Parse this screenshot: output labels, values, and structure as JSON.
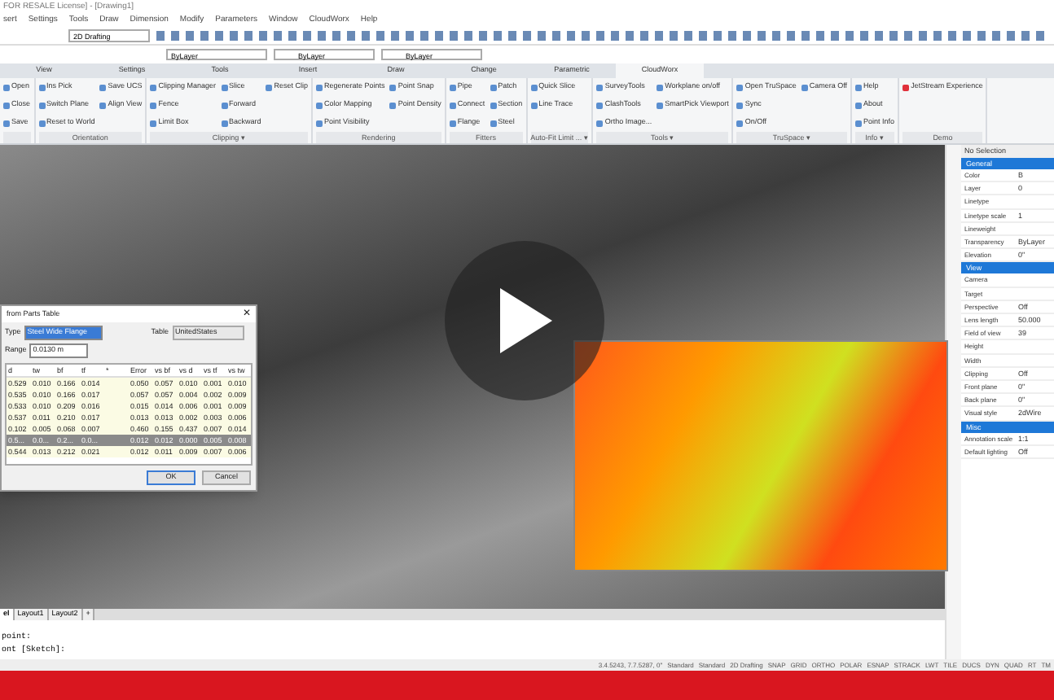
{
  "window": {
    "title": "FOR RESALE License] - [Drawing1]"
  },
  "menu": [
    "sert",
    "Settings",
    "Tools",
    "Draw",
    "Dimension",
    "Modify",
    "Parameters",
    "Window",
    "CloudWorx",
    "Help"
  ],
  "toolbar": {
    "workspace": "2D Drafting",
    "layer": "ByLayer",
    "linetype": "ByLayer",
    "lineweight": "ByLayer"
  },
  "ribbon_tabs": [
    {
      "label": "View",
      "selected": false
    },
    {
      "label": "Settings",
      "selected": false
    },
    {
      "label": "Tools",
      "selected": false
    },
    {
      "label": "Insert",
      "selected": false
    },
    {
      "label": "Draw",
      "selected": false
    },
    {
      "label": "Change",
      "selected": false
    },
    {
      "label": "Parametric",
      "selected": false
    },
    {
      "label": "CloudWorx",
      "selected": true
    }
  ],
  "ribbon_groups": [
    {
      "items": [
        "Open",
        "Close",
        "Save"
      ]
    },
    {
      "label": "Orientation",
      "items": [
        "Ins Pick",
        "Switch Plane",
        "Reset to World",
        "Save UCS",
        "Align View"
      ]
    },
    {
      "label": "Clipping ▾",
      "items": [
        "Clipping Manager",
        "Fence",
        "Limit Box",
        "Slice",
        "Forward",
        "Backward",
        "Reset Clip"
      ]
    },
    {
      "label": "Rendering",
      "items": [
        "Regenerate Points",
        "Color Mapping",
        "Point Visibility",
        "Point Snap",
        "Point Density"
      ]
    },
    {
      "label": "Fitters",
      "items": [
        "Pipe",
        "Connect",
        "Flange",
        "Patch",
        "Section",
        "Steel"
      ]
    },
    {
      "label": "Auto-Fit Limit ... ▾",
      "items": [
        "Quick Slice",
        "Line Trace"
      ]
    },
    {
      "label": "Tools ▾",
      "items": [
        "SurveyTools",
        "ClashTools",
        "Ortho Image...",
        "Workplane on/off",
        "SmartPick Viewport"
      ]
    },
    {
      "label": "TruSpace ▾",
      "items": [
        "Open TruSpace",
        "Sync",
        "On/Off",
        "Camera Off"
      ]
    },
    {
      "label": "Info ▾",
      "items": [
        "Help",
        "About",
        "Point Info"
      ]
    },
    {
      "label": "Demo",
      "items": [
        "JetStream Experience"
      ]
    }
  ],
  "dialog": {
    "title": "from Parts Table",
    "close": "✕",
    "type_label": "Type",
    "type_value": "Steel Wide Flange",
    "table_label": "Table",
    "table_value": "UnitedStates",
    "range_label": "Range",
    "range_value": "0.0130 m",
    "columns": [
      "d",
      "tw",
      "bf",
      "tf",
      "*",
      "Error",
      "vs bf",
      "vs d",
      "vs tf",
      "vs tw"
    ],
    "rows": [
      {
        "cells": [
          "0.529",
          "0.010",
          "0.166",
          "0.014",
          "",
          "0.050",
          "0.057",
          "0.010",
          "0.001",
          "0.010"
        ],
        "selected": false
      },
      {
        "cells": [
          "0.535",
          "0.010",
          "0.166",
          "0.017",
          "",
          "0.057",
          "0.057",
          "0.004",
          "0.002",
          "0.009"
        ],
        "selected": false
      },
      {
        "cells": [
          "0.533",
          "0.010",
          "0.209",
          "0.016",
          "",
          "0.015",
          "0.014",
          "0.006",
          "0.001",
          "0.009"
        ],
        "selected": false
      },
      {
        "cells": [
          "0.537",
          "0.011",
          "0.210",
          "0.017",
          "",
          "0.013",
          "0.013",
          "0.002",
          "0.003",
          "0.006"
        ],
        "selected": false
      },
      {
        "cells": [
          "0.102",
          "0.005",
          "0.068",
          "0.007",
          "",
          "0.460",
          "0.155",
          "0.437",
          "0.007",
          "0.014"
        ],
        "selected": false
      },
      {
        "cells": [
          "0.5...",
          "0.0...",
          "0.2...",
          "0.0...",
          "",
          "0.012",
          "0.012",
          "0.000",
          "0.005",
          "0.008"
        ],
        "selected": true
      },
      {
        "cells": [
          "0.544",
          "0.013",
          "0.212",
          "0.021",
          "",
          "0.012",
          "0.011",
          "0.009",
          "0.007",
          "0.006"
        ],
        "selected": false
      }
    ],
    "buttons": [
      "OK",
      "Cancel"
    ]
  },
  "properties": {
    "header": "No Selection",
    "sections": [
      {
        "title": "General",
        "rows": [
          [
            "Color",
            "B"
          ],
          [
            "Layer",
            "0"
          ],
          [
            "Linetype",
            ""
          ],
          [
            "Linetype scale",
            "1"
          ],
          [
            "Lineweight",
            ""
          ],
          [
            "Transparency",
            "ByLayer"
          ],
          [
            "Elevation",
            "0\""
          ]
        ]
      },
      {
        "title": "View",
        "rows": [
          [
            "Camera",
            ""
          ],
          [
            "Target",
            ""
          ],
          [
            "Perspective",
            "Off"
          ],
          [
            "Lens length",
            "50.000"
          ],
          [
            "Field of view",
            "39"
          ],
          [
            "Height",
            ""
          ],
          [
            "Width",
            ""
          ],
          [
            "Clipping",
            "Off"
          ],
          [
            "Front plane",
            "0\""
          ],
          [
            "Back plane",
            "0\""
          ],
          [
            "Visual style",
            "2dWire"
          ]
        ]
      },
      {
        "title": "Misc",
        "rows": [
          [
            "Annotation scale",
            "1:1"
          ],
          [
            "Default lighting",
            "Off"
          ]
        ]
      }
    ]
  },
  "layout_tabs": [
    {
      "label": "el",
      "selected": true
    },
    {
      "label": "Layout1",
      "selected": false
    },
    {
      "label": "Layout2",
      "selected": false
    },
    {
      "label": "+",
      "selected": false
    }
  ],
  "command_lines": [
    "point:",
    "ont [Sketch]:"
  ],
  "status_bar": [
    "3.4.5243, 7.7.5287, 0\"",
    "Standard",
    "Standard",
    "2D Drafting",
    "SNAP",
    "GRID",
    "ORTHO",
    "POLAR",
    "ESNAP",
    "STRACK",
    "LWT",
    "TILE",
    "DUCS",
    "DYN",
    "QUAD",
    "RT",
    "TM"
  ]
}
